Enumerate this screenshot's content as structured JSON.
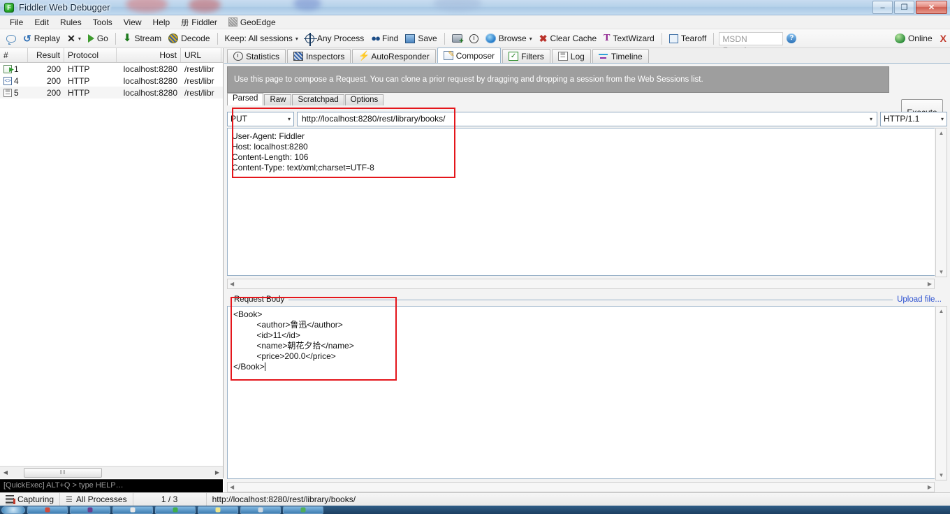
{
  "window": {
    "title": "Fiddler Web Debugger",
    "app_icon": "fiddler-icon",
    "minimize_label": "–",
    "restore_label": "❐",
    "close_label": "✕"
  },
  "menubar": {
    "items": [
      {
        "label": "File",
        "icon": null
      },
      {
        "label": "Edit",
        "icon": null
      },
      {
        "label": "Rules",
        "icon": null
      },
      {
        "label": "Tools",
        "icon": null
      },
      {
        "label": "View",
        "icon": null
      },
      {
        "label": "Help",
        "icon": null
      },
      {
        "label": "Fiddler",
        "icon": "cjk-glyph",
        "glyph": "册"
      },
      {
        "label": "GeoEdge",
        "icon": "geoedge-icon",
        "glyph": ""
      }
    ]
  },
  "toolbar": {
    "comment_label": "",
    "replay_label": "Replay",
    "remove_label": "",
    "go_label": "Go",
    "stream_label": "Stream",
    "decode_label": "Decode",
    "keep_label": "Keep: All sessions",
    "process_label": "Any Process",
    "find_label": "Find",
    "save_label": "Save",
    "browse_label": "Browse",
    "clear_cache_label": "Clear Cache",
    "textwizard_label": "TextWizard",
    "tearoff_label": "Tearoff",
    "msdn_placeholder": "MSDN Search...",
    "help_label": "?",
    "online_label": "Online",
    "online_close_label": "X",
    "caret": "▾"
  },
  "sessions": {
    "columns": [
      "#",
      "Result",
      "Protocol",
      "Host",
      "URL"
    ],
    "rows": [
      {
        "icon": "doc-arrow",
        "num": "1",
        "result": "200",
        "protocol": "HTTP",
        "host": "localhost:8280",
        "url": "/rest/libr"
      },
      {
        "icon": "xml",
        "num": "4",
        "result": "200",
        "protocol": "HTTP",
        "host": "localhost:8280",
        "url": "/rest/libr"
      },
      {
        "icon": "plain",
        "num": "5",
        "result": "200",
        "protocol": "HTTP",
        "host": "localhost:8280",
        "url": "/rest/libr"
      }
    ],
    "hscroll_thumb": "‖‖",
    "scroll_left": "◀",
    "scroll_right": "▶"
  },
  "quickexec": {
    "text": "[QuickExec] ALT+Q > type HELP…"
  },
  "main_tabs": [
    {
      "label": "Statistics",
      "icon": "statistics-icon",
      "active": false
    },
    {
      "label": "Inspectors",
      "icon": "inspectors-icon",
      "active": false
    },
    {
      "label": "AutoResponder",
      "icon": "autoresponder-icon",
      "active": false
    },
    {
      "label": "Composer",
      "icon": "composer-icon",
      "active": true
    },
    {
      "label": "Filters",
      "icon": "filters-icon",
      "active": false
    },
    {
      "label": "Log",
      "icon": "log-icon",
      "active": false
    },
    {
      "label": "Timeline",
      "icon": "timeline-icon",
      "active": false
    }
  ],
  "composer": {
    "info_text": "Use this page to compose a Request. You can clone a prior request by dragging and dropping a session from the Web Sessions list.",
    "execute_button": "Execute",
    "execute_accel": "E",
    "sub_tabs": [
      {
        "label": "Parsed",
        "active": true
      },
      {
        "label": "Raw",
        "active": false
      },
      {
        "label": "Scratchpad",
        "active": false
      },
      {
        "label": "Options",
        "active": false
      }
    ],
    "method": "PUT",
    "url": "http://localhost:8280/rest/library/books/",
    "http_version": "HTTP/1.1",
    "headers": "User-Agent: Fiddler\nHost: localhost:8280\nContent-Length: 106\nContent-Type: text/xml;charset=UTF-8",
    "body_label": "Request Body",
    "upload_link": "Upload file...",
    "body": "<Book>\n          <author>鲁迅</author>\n          <id>11</id>\n          <name>朝花夕拾</name>\n          <price>200.0</price>\n</Book>"
  },
  "statusbar": {
    "capturing": "Capturing",
    "processes": "All Processes",
    "count": "1 / 3",
    "url": "http://localhost:8280/rest/library/books/"
  },
  "annotations": {
    "accent_color": "#e4161b",
    "box_request_label": "request-line-and-headers-highlight",
    "box_body_label": "request-body-highlight"
  },
  "taskbar": {
    "items": [
      "start",
      "app1",
      "app2",
      "app3",
      "app4",
      "app5",
      "app6",
      "app7"
    ]
  }
}
